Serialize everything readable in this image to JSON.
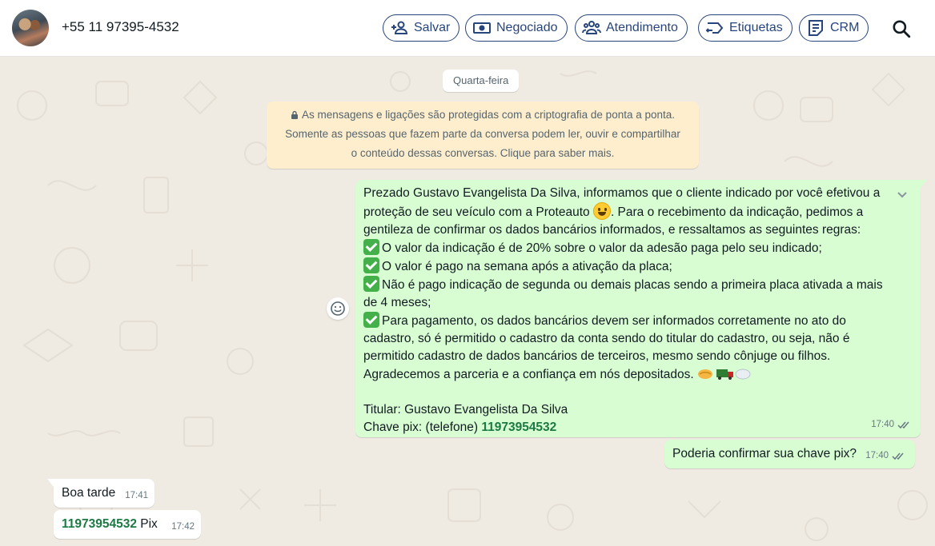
{
  "header": {
    "contact": "+55 11 97395-4532",
    "buttons": [
      {
        "label": "Salvar",
        "icon": "add-person-icon"
      },
      {
        "label": "Negociado",
        "icon": "money-icon"
      },
      {
        "label": "Atendimento",
        "icon": "people-icon"
      },
      {
        "label": "Etiquetas",
        "icon": "tag-icon"
      },
      {
        "label": "CRM",
        "icon": "note-icon"
      }
    ],
    "search_icon": "search-icon"
  },
  "chat": {
    "date_label": "Quarta-feira",
    "encryption": [
      "As mensagens e ligações são protegidas com a criptografia de ponta a ponta.",
      "Somente as pessoas que fazem parte da conversa podem ler, ouvir e compartilhar",
      "o conteúdo dessas conversas. Clique para saber mais."
    ],
    "long_message": {
      "l1": "Prezado Gustavo Evangelista Da Silva, informamos que o cliente indicado por você efetivou a",
      "l2a": "proteção de seu veículo com a Proteauto ",
      "l2b": ". Para o recebimento da indicação, pedimos a",
      "l3": "gentileza de confirmar os dados bancários informados, e  ressaltamos as seguintes regras:",
      "l4": "O valor da indicação é de 20% sobre o valor da adesão paga pelo seu indicado;",
      "l5": "O valor é pago na semana após a ativação da placa;",
      "l6": "Não é pago indicação de segunda ou demais placas sendo a primeira placa ativada a mais",
      "l7": "de 4 meses;",
      "l8": "Para pagamento, os dados bancários devem ser informados corretamente no ato do",
      "l9": "cadastro, só é permitido o cadastro da conta sendo do titular do cadastro, ou seja, não é",
      "l10": "permitido cadastro de dados bancários de terceiros, mesmo sendo cônjuge ou filhos.",
      "l11": "Agradecemos a parceria e a confiança em nós depositados. ",
      "l12": "Titular: Gustavo Evangelista Da Silva",
      "l13": "Chave pix: (telefone) ",
      "pix": "11973954532",
      "time": "17:40"
    },
    "short_out": {
      "text": "Poderia confirmar sua chave pix?",
      "time": "17:40"
    },
    "in1": {
      "text": "Boa tarde",
      "time": "17:41"
    },
    "in2": {
      "pix": "11973954532",
      "text": " Pix",
      "time": "17:42"
    }
  }
}
